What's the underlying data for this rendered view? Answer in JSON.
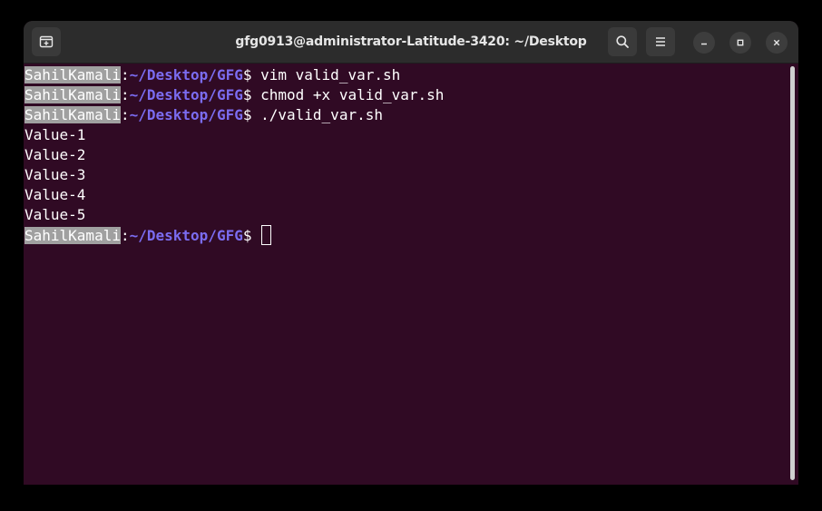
{
  "window": {
    "title": "gfg0913@administrator-Latitude-3420: ~/Desktop"
  },
  "icons": {
    "new_tab": "new-tab-icon",
    "search": "search-icon",
    "menu": "hamburger-menu-icon",
    "minimize": "minimize-icon",
    "maximize": "maximize-icon",
    "close": "close-icon"
  },
  "colors": {
    "terminal_bg": "#300a24",
    "titlebar_bg": "#2c2c2c",
    "prompt_path": "#7b6cf0",
    "user_highlight": "#a0a0a0"
  },
  "terminal": {
    "prompt": {
      "user": "SahilKamali",
      "separator": ":",
      "path": "~/Desktop/GFG",
      "symbol": "$"
    },
    "commands": [
      " vim valid_var.sh",
      " chmod +x valid_var.sh",
      " ./valid_var.sh"
    ],
    "output": [
      "Value-1",
      "Value-2",
      "Value-3",
      "Value-4",
      "Value-5"
    ],
    "final_prompt_suffix": " "
  }
}
